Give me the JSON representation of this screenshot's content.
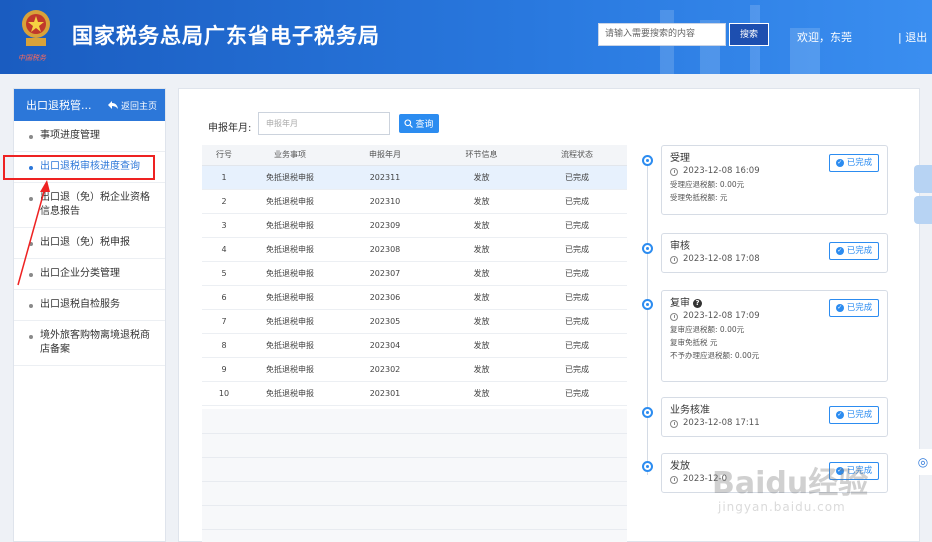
{
  "header": {
    "title": "国家税务总局广东省电子税务局",
    "emblem_caption": "中国税务",
    "search_placeholder": "请输入需要搜索的内容",
    "search_button": "搜索",
    "welcome": "欢迎，东莞",
    "logout": "| 退出"
  },
  "sidebar": {
    "title": "出口退税管...",
    "back_label": "返回主页",
    "items": [
      {
        "label": "事项进度管理"
      },
      {
        "label": "出口退税审核进度查询"
      },
      {
        "label": "出口退（免）税企业资格信息报告"
      },
      {
        "label": "出口退（免）税申报"
      },
      {
        "label": "出口企业分类管理"
      },
      {
        "label": "出口退税自检服务"
      },
      {
        "label": "境外旅客购物离境退税商店备案"
      }
    ]
  },
  "filter": {
    "label": "申报年月:",
    "placeholder": "申报年月",
    "query_button": "查询"
  },
  "table": {
    "headers": [
      "行号",
      "业务事项",
      "申报年月",
      "环节信息",
      "流程状态"
    ],
    "rows": [
      [
        "1",
        "免抵退税申报",
        "202311",
        "发放",
        "已完成"
      ],
      [
        "2",
        "免抵退税申报",
        "202310",
        "发放",
        "已完成"
      ],
      [
        "3",
        "免抵退税申报",
        "202309",
        "发放",
        "已完成"
      ],
      [
        "4",
        "免抵退税申报",
        "202308",
        "发放",
        "已完成"
      ],
      [
        "5",
        "免抵退税申报",
        "202307",
        "发放",
        "已完成"
      ],
      [
        "6",
        "免抵退税申报",
        "202306",
        "发放",
        "已完成"
      ],
      [
        "7",
        "免抵退税申报",
        "202305",
        "发放",
        "已完成"
      ],
      [
        "8",
        "免抵退税申报",
        "202304",
        "发放",
        "已完成"
      ],
      [
        "9",
        "免抵退税申报",
        "202302",
        "发放",
        "已完成"
      ],
      [
        "10",
        "免抵退税申报",
        "202301",
        "发放",
        "已完成"
      ]
    ]
  },
  "timeline": [
    {
      "title": "受理",
      "time": "2023-12-08 16:09",
      "badge": "已完成",
      "lines": [
        "受理应退税额: 0.00元",
        "受理免抵税额:        元"
      ]
    },
    {
      "title": "审核",
      "time": "2023-12-08 17:08",
      "badge": "已完成",
      "lines": []
    },
    {
      "title": "复审",
      "time": "2023-12-08 17:09",
      "badge": "已完成",
      "lines": [
        "复审应退税额: 0.00元",
        "复审免抵税        元",
        "不予办理应退税额: 0.00元"
      ]
    },
    {
      "title": "业务核准",
      "time": "2023-12-08 17:11",
      "badge": "已完成",
      "lines": []
    },
    {
      "title": "发放",
      "time": "2023-12-0",
      "badge": "已完成",
      "lines": []
    }
  ],
  "watermark": {
    "text": "Baidu经验",
    "sub": "jingyan.baidu.com"
  },
  "colors": {
    "header": "#2a7ae0",
    "accent": "#2c8cf0",
    "highlight": "#e22222"
  }
}
